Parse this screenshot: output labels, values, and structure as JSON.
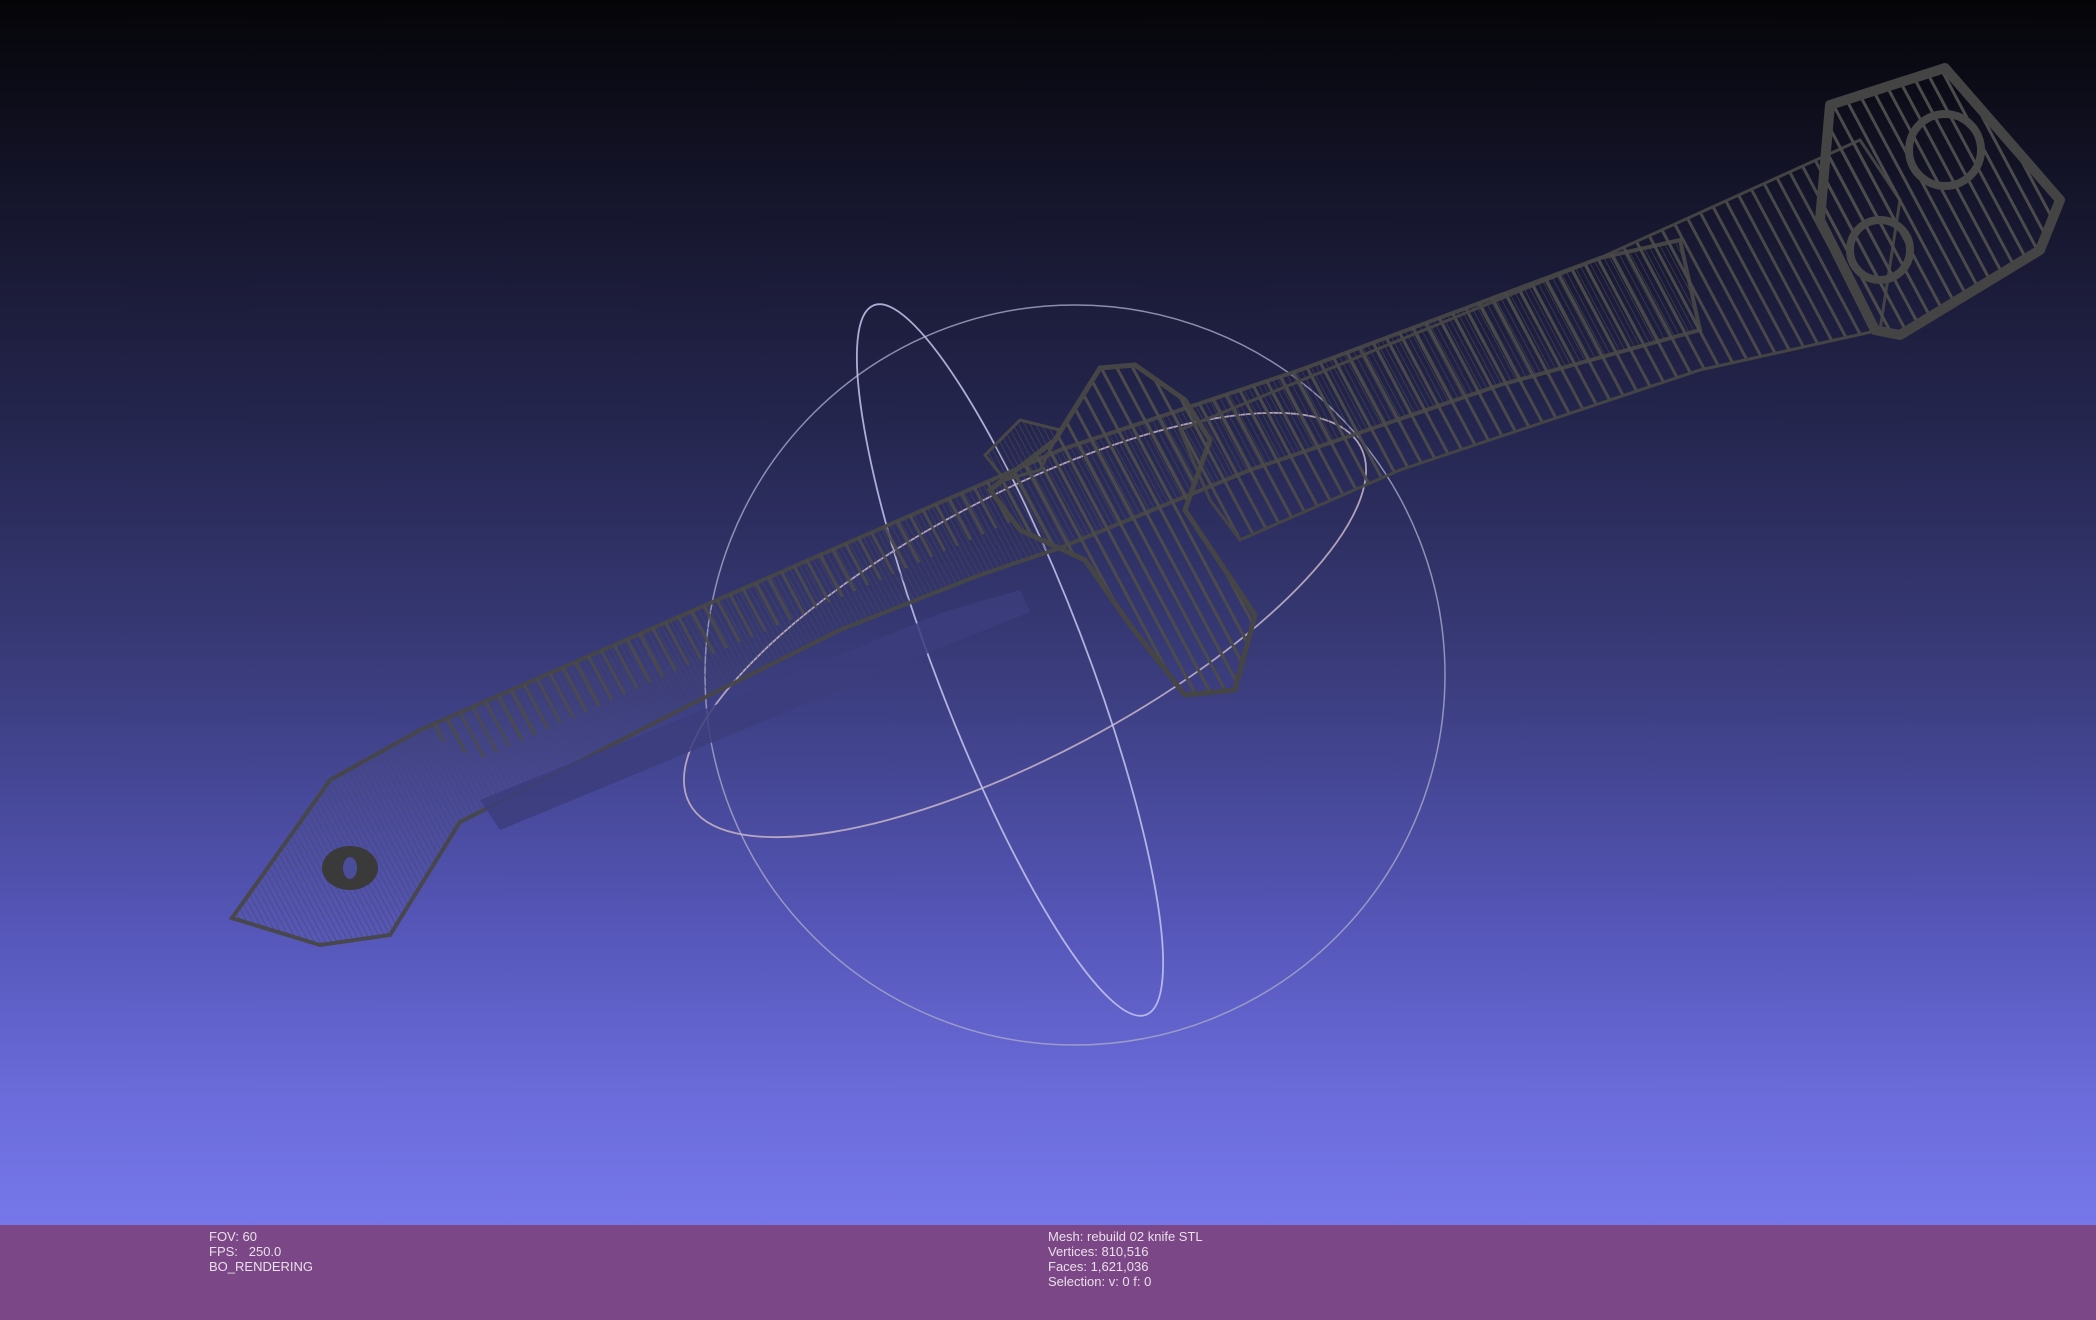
{
  "info_left": {
    "fov": "FOV: 60",
    "fps": "FPS:   250.0",
    "render_mode": "BO_RENDERING"
  },
  "info_right": {
    "mesh": "Mesh: rebuild 02 knife STL",
    "vertices": "Vertices: 810,516",
    "faces": "Faces: 1,621,036",
    "selection": "Selection: v: 0 f: 0"
  },
  "colors": {
    "background_top": "#050508",
    "background_bottom": "#7677e9",
    "info_bar": "#7c4786",
    "mesh_wire": "#4a4a4a",
    "trackball_ring": "#b8b8d8"
  }
}
